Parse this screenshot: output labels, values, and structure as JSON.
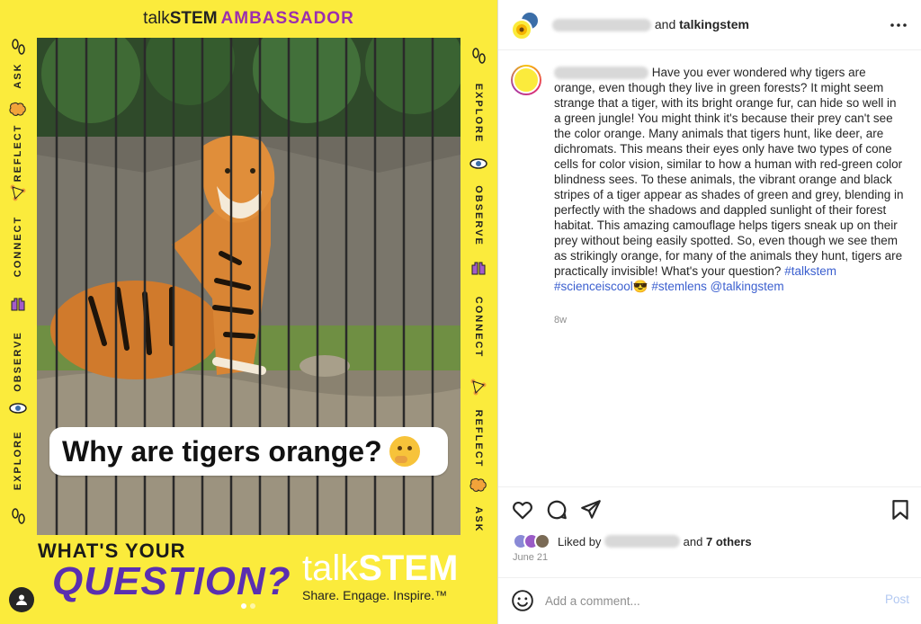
{
  "image": {
    "header_talk": "talk",
    "header_stem": "STEM",
    "header_ambassador": "AMBASSADOR",
    "question": "Why are tigers orange?",
    "wyq_line1": "WHAT'S YOUR",
    "wyq_line2": "QUESTION?",
    "brand_talk": "talk",
    "brand_stem": "STEM",
    "brand_tagline": "Share. Engage. Inspire.™",
    "rail_left": [
      "ASK",
      "REFLECT",
      "CONNECT",
      "OBSERVE",
      "EXPLORE"
    ],
    "rail_right": [
      "EXPLORE",
      "OBSERVE",
      "CONNECT",
      "REFLECT",
      "ASK"
    ]
  },
  "header": {
    "connector": "and",
    "collaborator": "talkingstem"
  },
  "caption": {
    "text": "Have you ever wondered why tigers are orange, even though they live in green forests? It might seem strange that a tiger, with its bright orange fur, can hide so well in a green jungle! You might think it's because their prey can't see the color orange. Many animals that tigers hunt, like deer, are dichromats. This means their eyes only have two types of cone cells for color vision, similar to how a human with red-green color blindness sees. To these animals, the vibrant orange and black stripes of a tiger appear as shades of green and grey, blending in perfectly with the shadows and dappled sunlight of their forest habitat. This amazing camouflage helps tigers sneak up on their prey without being easily spotted. So, even though we see them as strikingly orange, for many of the animals they hunt, tigers are practically invisible! What's your question?",
    "hashtags": [
      "#talkstem",
      "#scienceiscool😎",
      "#stemlens"
    ],
    "mention": "@talkingstem",
    "time": "8w"
  },
  "likes": {
    "prefix": "Liked by",
    "connector": "and",
    "others": "7 others"
  },
  "date": "June 21",
  "comment": {
    "placeholder": "Add a comment...",
    "post_label": "Post"
  },
  "colors": {
    "brand_yellow": "#fbeb3c",
    "ambassador_purple": "#9b2fae",
    "link_blue": "#3b5fcf",
    "post_disabled": "#b3c9f2"
  },
  "icons": [
    "more-icon",
    "heart-icon",
    "comment-icon",
    "share-icon",
    "bookmark-icon",
    "emoji-icon",
    "user-tag-icon"
  ]
}
